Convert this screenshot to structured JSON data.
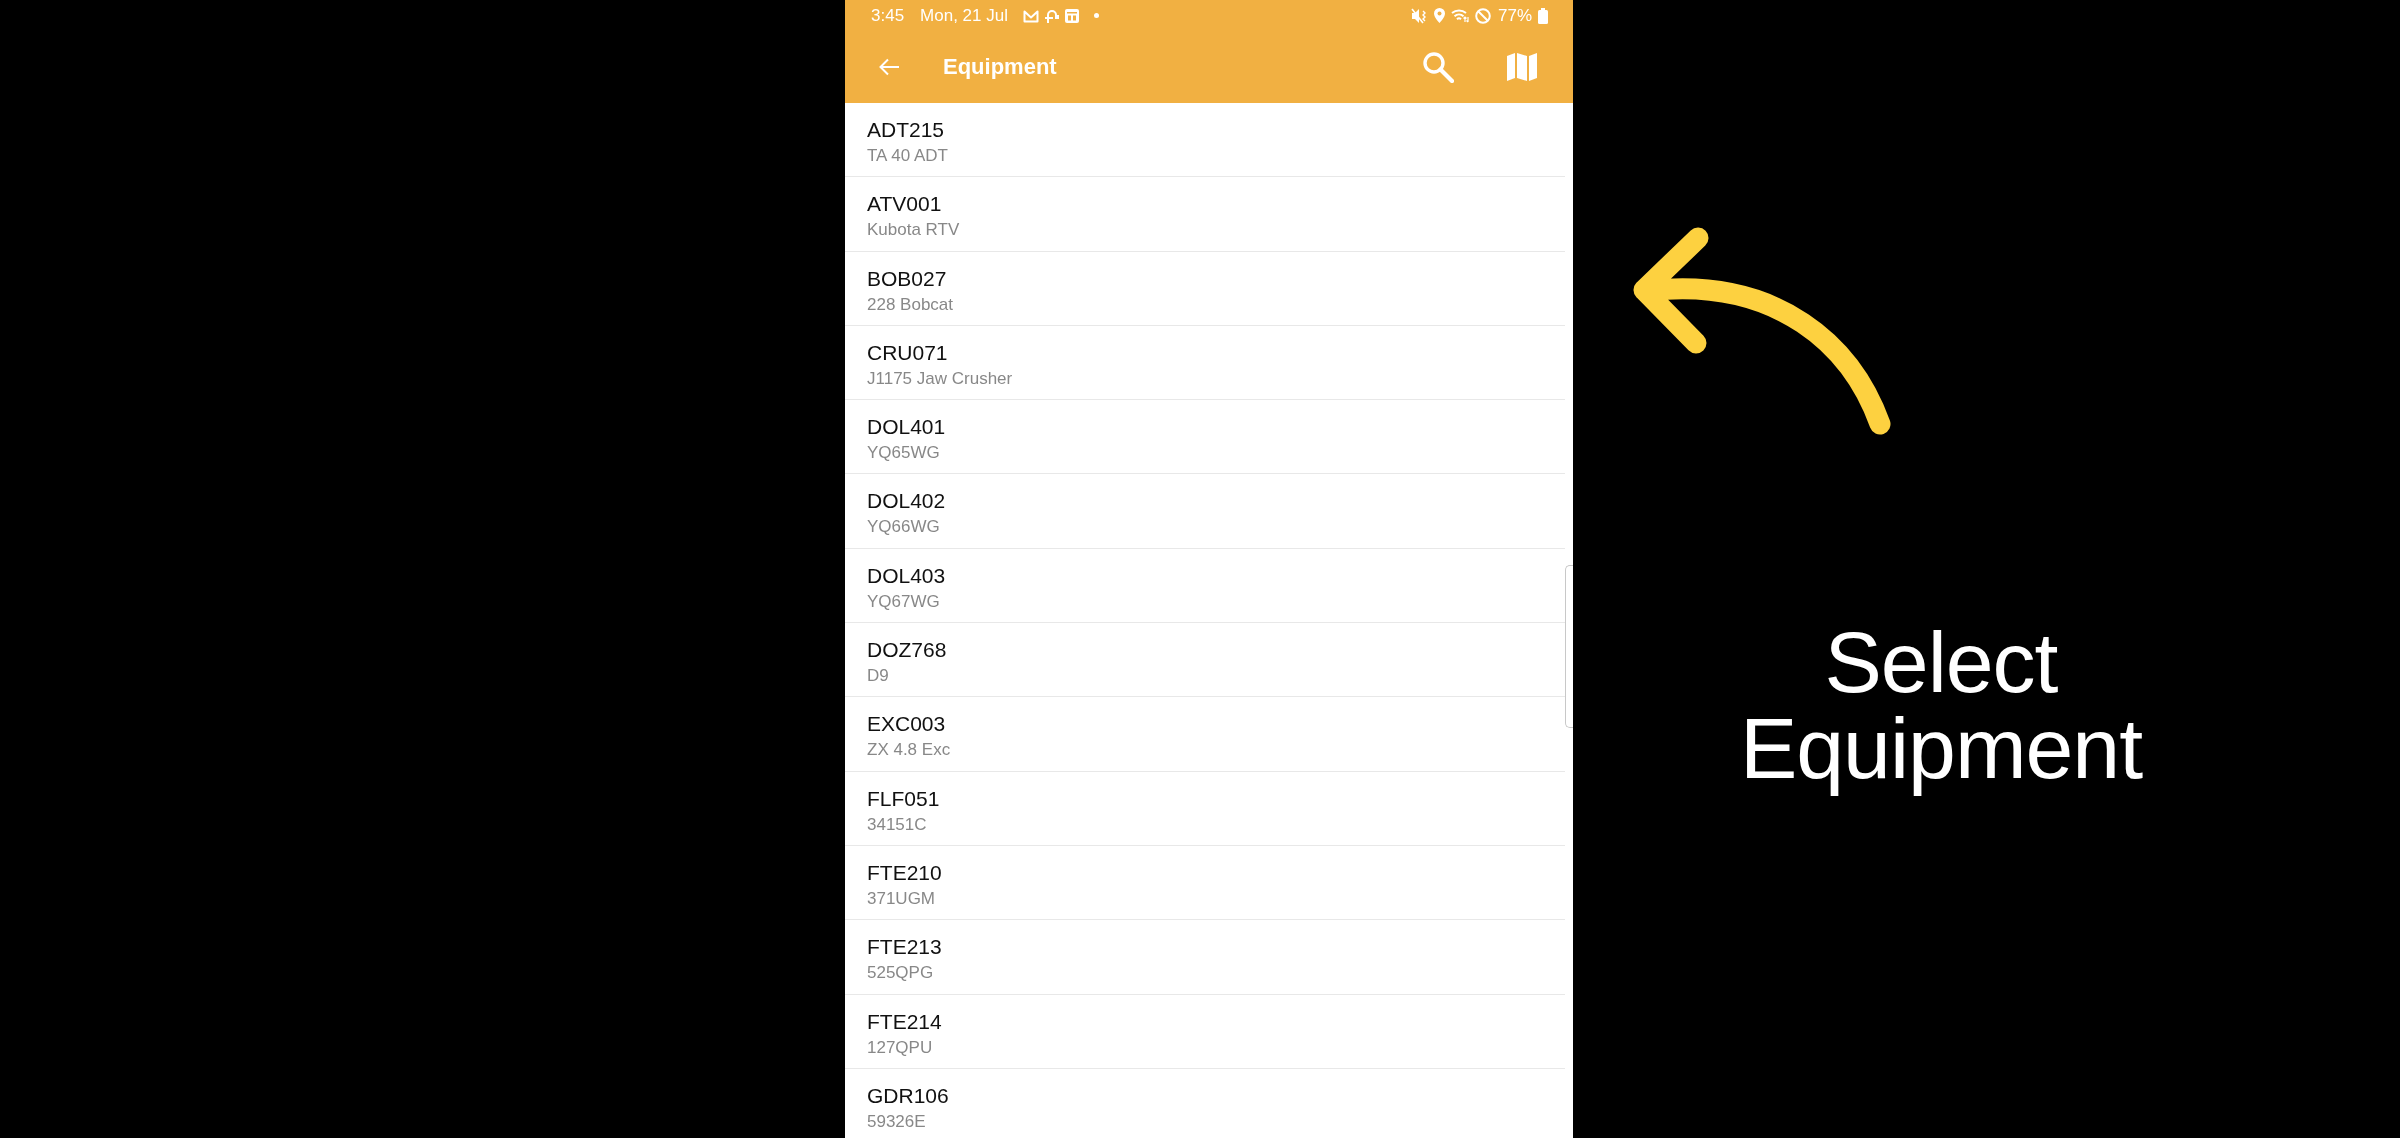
{
  "status_bar": {
    "time": "3:45",
    "date": "Mon, 21 Jul",
    "battery": "77%"
  },
  "app_bar": {
    "title": "Equipment"
  },
  "equipment_list": [
    {
      "code": "ADT215",
      "description": "TA 40 ADT"
    },
    {
      "code": "ATV001",
      "description": "Kubota RTV"
    },
    {
      "code": "BOB027",
      "description": "228 Bobcat"
    },
    {
      "code": "CRU071",
      "description": "J1175 Jaw Crusher"
    },
    {
      "code": "DOL401",
      "description": "YQ65WG"
    },
    {
      "code": "DOL402",
      "description": "YQ66WG"
    },
    {
      "code": "DOL403",
      "description": "YQ67WG"
    },
    {
      "code": "DOZ768",
      "description": "D9"
    },
    {
      "code": "EXC003",
      "description": "ZX 4.8 Exc"
    },
    {
      "code": "FLF051",
      "description": "34151C"
    },
    {
      "code": "FTE210",
      "description": "371UGM"
    },
    {
      "code": "FTE213",
      "description": "525QPG"
    },
    {
      "code": "FTE214",
      "description": "127QPU"
    },
    {
      "code": "GDR106",
      "description": "59326E"
    }
  ],
  "overlay": {
    "caption": "Select Equipment"
  }
}
